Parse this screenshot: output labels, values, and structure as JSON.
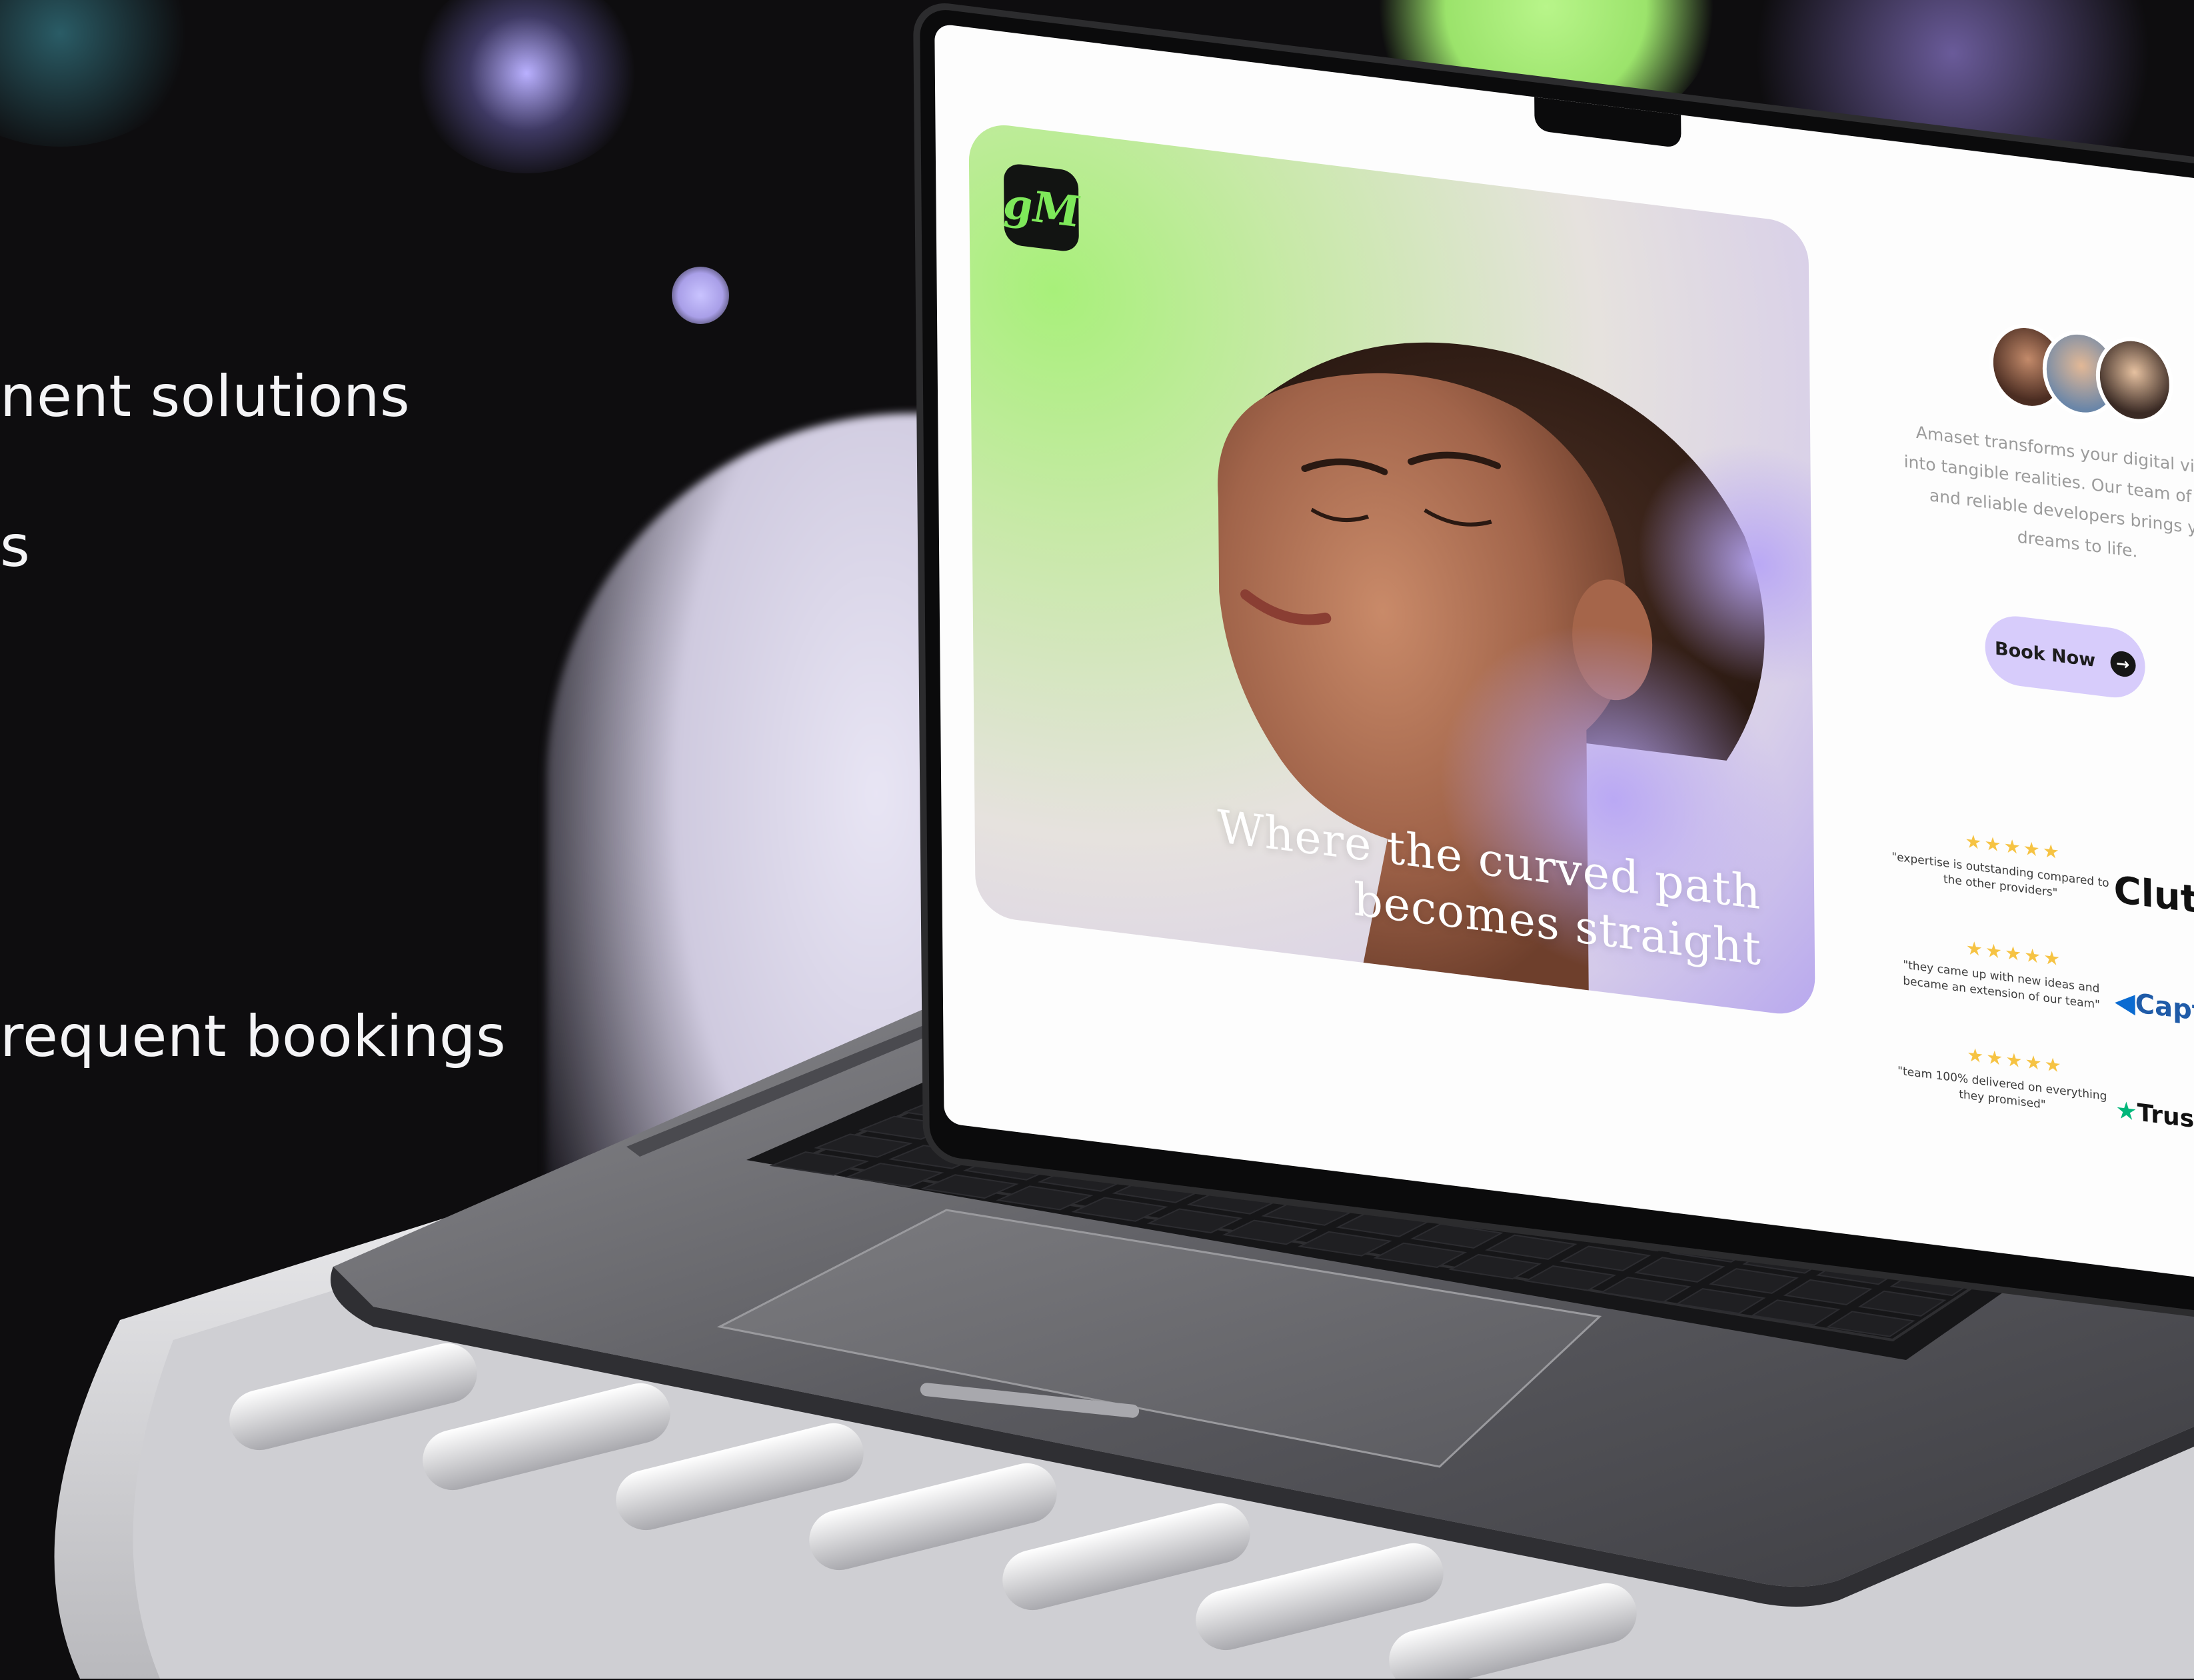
{
  "left_copy": {
    "line1": "nent solutions",
    "line2": "s",
    "line3": "requent bookings"
  },
  "site": {
    "logo_text": "gM",
    "tagline_line1": "Where the curved path",
    "tagline_line2": "becomes straight",
    "description": "Amaset transforms your digital visions into tangible realities. Our team of skilled and reliable developers brings your dreams to life.",
    "book_button": "Book Now",
    "reviews": [
      {
        "stars": "★★★★★",
        "quote": "\"expertise is outstanding compared to the other providers\"",
        "brand": "Clutch"
      },
      {
        "stars": "★★★★★",
        "quote": "\"they came up with new ideas and became an extension of our team\"",
        "brand": "Capterra"
      },
      {
        "stars": "★★★★★",
        "quote": "\"team 100% delivered on everything they promised\"",
        "brand": "Trustpilot"
      }
    ]
  },
  "colors": {
    "background": "#0e0d0f",
    "accent_green": "#a8f07a",
    "accent_lavender": "#d7ccfb",
    "star": "#f6c343"
  }
}
